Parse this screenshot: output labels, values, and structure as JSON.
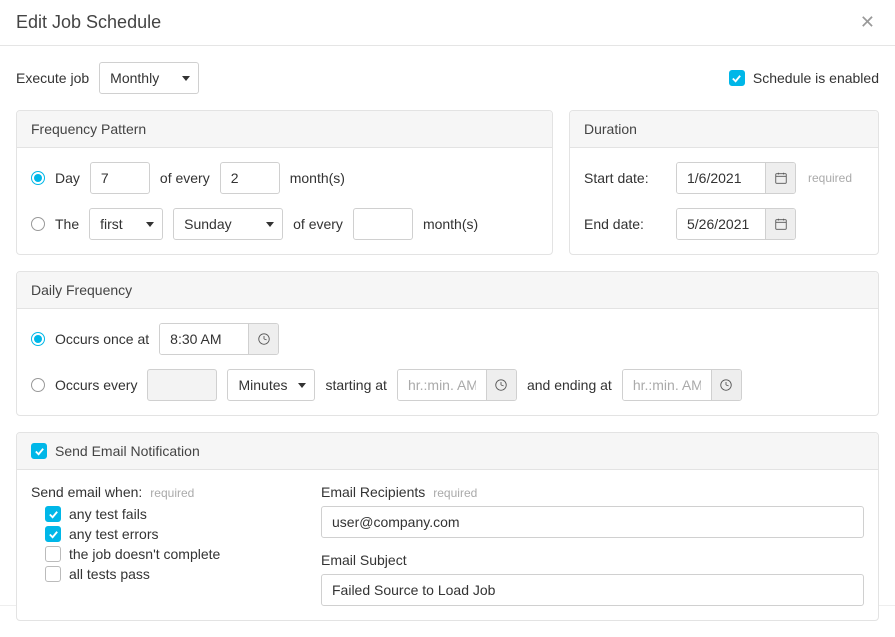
{
  "header": {
    "title": "Edit Job Schedule"
  },
  "toprow": {
    "execute_label": "Execute job",
    "execute_value": "Monthly",
    "enabled_label": "Schedule is enabled",
    "enabled_checked": true
  },
  "frequency": {
    "title": "Frequency Pattern",
    "day_label": "Day",
    "day_value": "7",
    "of_every": "of every",
    "every_months_value": "2",
    "months_suffix": "month(s)",
    "the_label": "The",
    "ordinal_value": "first",
    "weekday_value": "Sunday",
    "the_every_value": ""
  },
  "duration": {
    "title": "Duration",
    "start_label": "Start date:",
    "start_value": "1/6/2021",
    "end_label": "End date:",
    "end_value": "5/26/2021",
    "required": "required"
  },
  "daily": {
    "title": "Daily Frequency",
    "once_label": "Occurs once at",
    "once_value": "8:30 AM",
    "every_label": "Occurs every",
    "every_value": "",
    "unit_value": "Minutes",
    "starting_label": "starting at",
    "starting_placeholder": "hr.:min. AM",
    "ending_label": "and ending at",
    "ending_placeholder": "hr.:min. AM"
  },
  "notif": {
    "title": "Send Email Notification",
    "title_checked": true,
    "when_label": "Send email when:",
    "required": "required",
    "cond": {
      "fails": {
        "label": "any test fails",
        "checked": true
      },
      "errors": {
        "label": "any test errors",
        "checked": true
      },
      "incomplete": {
        "label": "the job doesn't complete",
        "checked": false
      },
      "pass": {
        "label": "all tests pass",
        "checked": false
      }
    },
    "recipients_label": "Email Recipients",
    "recipients_value": "user@company.com",
    "subject_label": "Email Subject",
    "subject_value": "Failed Source to Load Job"
  }
}
